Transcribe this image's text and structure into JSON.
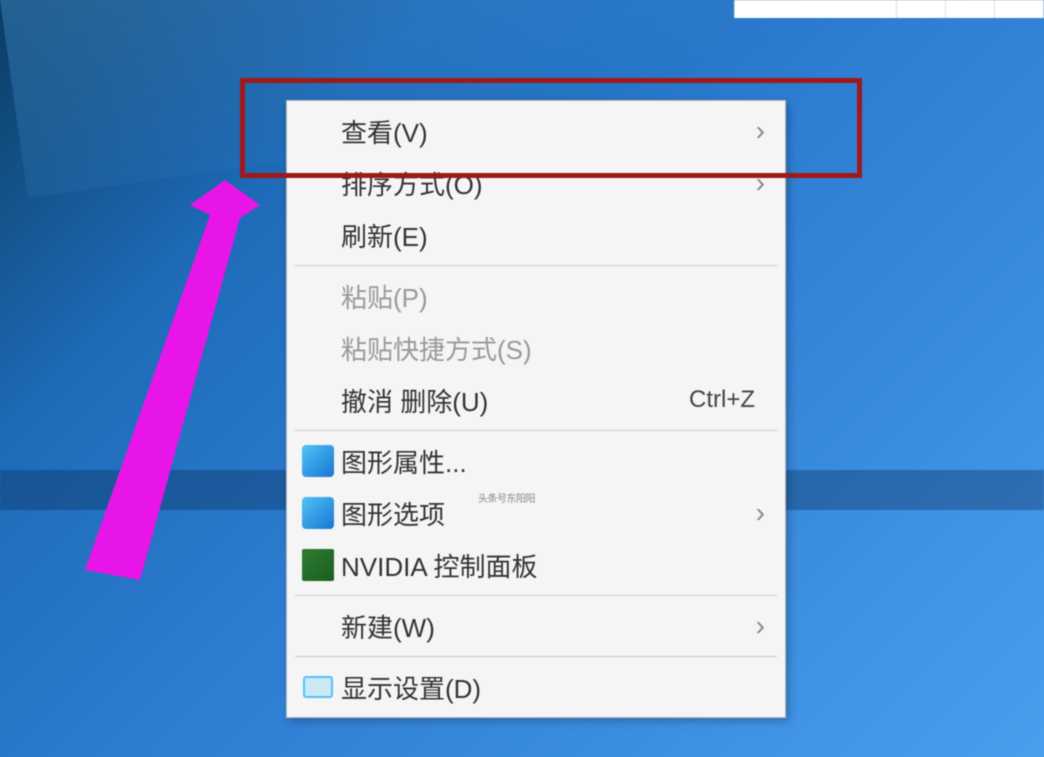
{
  "contextMenu": {
    "items": [
      {
        "label": "查看(V)",
        "hasSubmenu": true,
        "disabled": false,
        "shortcut": "",
        "iconType": ""
      },
      {
        "label": "排序方式(O)",
        "hasSubmenu": true,
        "disabled": false,
        "shortcut": "",
        "iconType": ""
      },
      {
        "label": "刷新(E)",
        "hasSubmenu": false,
        "disabled": false,
        "shortcut": "",
        "iconType": ""
      },
      {
        "label": "粘贴(P)",
        "hasSubmenu": false,
        "disabled": true,
        "shortcut": "",
        "iconType": ""
      },
      {
        "label": "粘贴快捷方式(S)",
        "hasSubmenu": false,
        "disabled": true,
        "shortcut": "",
        "iconType": ""
      },
      {
        "label": "撤消 删除(U)",
        "hasSubmenu": false,
        "disabled": false,
        "shortcut": "Ctrl+Z",
        "iconType": ""
      },
      {
        "label": "图形属性...",
        "hasSubmenu": false,
        "disabled": false,
        "shortcut": "",
        "iconType": "intel-blue"
      },
      {
        "label": "图形选项",
        "hasSubmenu": true,
        "disabled": false,
        "shortcut": "",
        "iconType": "intel-blue"
      },
      {
        "label": "NVIDIA 控制面板",
        "hasSubmenu": false,
        "disabled": false,
        "shortcut": "",
        "iconType": "nvidia-green"
      },
      {
        "label": "新建(W)",
        "hasSubmenu": true,
        "disabled": false,
        "shortcut": "",
        "iconType": ""
      },
      {
        "label": "显示设置(D)",
        "hasSubmenu": false,
        "disabled": false,
        "shortcut": "",
        "iconType": "display-icon"
      }
    ],
    "separatorsAfterIndex": [
      2,
      5,
      8,
      9
    ]
  },
  "watermark": "头条号东阳阳",
  "annotation": {
    "highlightColor": "#a01818",
    "arrowColor": "#e815e8"
  }
}
